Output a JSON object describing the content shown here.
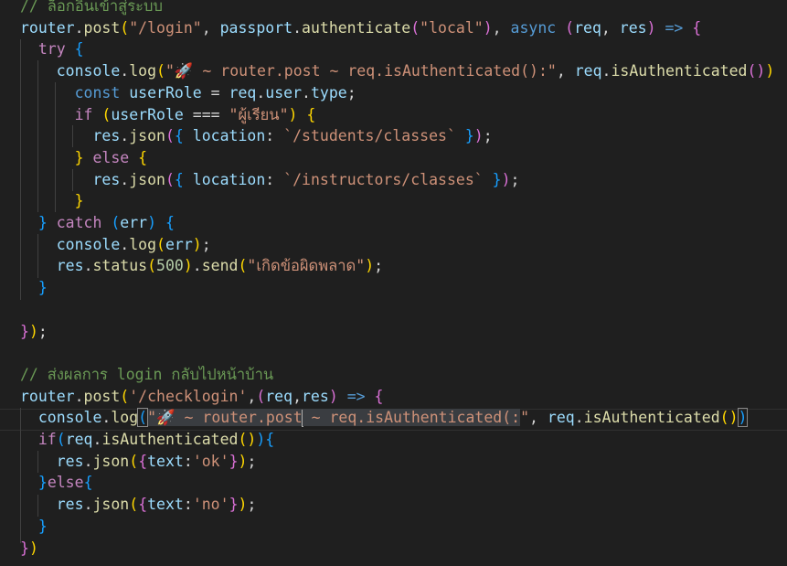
{
  "colors": {
    "background": "#1f1f1f",
    "comment": "#6a9955",
    "variable": "#9cdcfe",
    "function": "#dcdcaa",
    "string": "#ce9178",
    "keyword": "#569cd6",
    "control": "#c586c0",
    "number": "#b5cea8",
    "bracket_1": "#ffd700",
    "bracket_2": "#da70d6",
    "bracket_3": "#179fff"
  },
  "icons": {
    "rocket": "rocket-emoji"
  },
  "code": {
    "lines": [
      [
        [
          "cmt",
          "// ล็อกอินเข้าสู่ระบบ"
        ]
      ],
      [
        [
          "var",
          "router"
        ],
        [
          "txt",
          "."
        ],
        [
          "fn",
          "post"
        ],
        [
          "p1",
          "("
        ],
        [
          "str",
          "\"/login\""
        ],
        [
          "txt",
          ", "
        ],
        [
          "var",
          "passport"
        ],
        [
          "txt",
          "."
        ],
        [
          "fn",
          "authenticate"
        ],
        [
          "p2",
          "("
        ],
        [
          "str",
          "\"local\""
        ],
        [
          "p2",
          ")"
        ],
        [
          "txt",
          ", "
        ],
        [
          "kw",
          "async"
        ],
        [
          "txt",
          " "
        ],
        [
          "p2",
          "("
        ],
        [
          "var",
          "req"
        ],
        [
          "txt",
          ", "
        ],
        [
          "var",
          "res"
        ],
        [
          "p2",
          ")"
        ],
        [
          "txt",
          " "
        ],
        [
          "kw",
          "=>"
        ],
        [
          "txt",
          " "
        ],
        [
          "p2",
          "{"
        ]
      ],
      [
        [
          "txt",
          "  "
        ],
        [
          "ctl",
          "try"
        ],
        [
          "txt",
          " "
        ],
        [
          "p3",
          "{"
        ]
      ],
      [
        [
          "txt",
          "    "
        ],
        [
          "var",
          "console"
        ],
        [
          "txt",
          "."
        ],
        [
          "fn",
          "log"
        ],
        [
          "p1",
          "("
        ],
        [
          "str",
          "\"🚀 ~ router.post ~ req.isAuthenticated():\""
        ],
        [
          "txt",
          ", "
        ],
        [
          "var",
          "req"
        ],
        [
          "txt",
          "."
        ],
        [
          "fn",
          "isAuthenticated"
        ],
        [
          "p2",
          "()"
        ],
        [
          "p1",
          ")"
        ]
      ],
      [
        [
          "txt",
          "      "
        ],
        [
          "kw",
          "const"
        ],
        [
          "txt",
          " "
        ],
        [
          "var",
          "userRole"
        ],
        [
          "txt",
          " = "
        ],
        [
          "var",
          "req"
        ],
        [
          "txt",
          "."
        ],
        [
          "var",
          "user"
        ],
        [
          "txt",
          "."
        ],
        [
          "var",
          "type"
        ],
        [
          "txt",
          ";"
        ]
      ],
      [
        [
          "txt",
          "      "
        ],
        [
          "ctl",
          "if"
        ],
        [
          "txt",
          " "
        ],
        [
          "p1",
          "("
        ],
        [
          "var",
          "userRole"
        ],
        [
          "txt",
          " === "
        ],
        [
          "str",
          "\"ผู้เรียน\""
        ],
        [
          "p1",
          ")"
        ],
        [
          "txt",
          " "
        ],
        [
          "p1",
          "{"
        ]
      ],
      [
        [
          "txt",
          "        "
        ],
        [
          "var",
          "res"
        ],
        [
          "txt",
          "."
        ],
        [
          "fn",
          "json"
        ],
        [
          "p2",
          "("
        ],
        [
          "p3",
          "{"
        ],
        [
          "txt",
          " "
        ],
        [
          "var",
          "location"
        ],
        [
          "txt",
          ": "
        ],
        [
          "str",
          "`/students/classes`"
        ],
        [
          "txt",
          " "
        ],
        [
          "p3",
          "}"
        ],
        [
          "p2",
          ")"
        ],
        [
          "txt",
          ";"
        ]
      ],
      [
        [
          "txt",
          "      "
        ],
        [
          "p1",
          "}"
        ],
        [
          "txt",
          " "
        ],
        [
          "ctl",
          "else"
        ],
        [
          "txt",
          " "
        ],
        [
          "p1",
          "{"
        ]
      ],
      [
        [
          "txt",
          "        "
        ],
        [
          "var",
          "res"
        ],
        [
          "txt",
          "."
        ],
        [
          "fn",
          "json"
        ],
        [
          "p2",
          "("
        ],
        [
          "p3",
          "{"
        ],
        [
          "txt",
          " "
        ],
        [
          "var",
          "location"
        ],
        [
          "txt",
          ": "
        ],
        [
          "str",
          "`/instructors/classes`"
        ],
        [
          "txt",
          " "
        ],
        [
          "p3",
          "}"
        ],
        [
          "p2",
          ")"
        ],
        [
          "txt",
          ";"
        ]
      ],
      [
        [
          "txt",
          "      "
        ],
        [
          "p1",
          "}"
        ]
      ],
      [
        [
          "txt",
          "  "
        ],
        [
          "p3",
          "}"
        ],
        [
          "txt",
          " "
        ],
        [
          "ctl",
          "catch"
        ],
        [
          "txt",
          " "
        ],
        [
          "p3",
          "("
        ],
        [
          "var",
          "err"
        ],
        [
          "p3",
          ")"
        ],
        [
          "txt",
          " "
        ],
        [
          "p3",
          "{"
        ]
      ],
      [
        [
          "txt",
          "    "
        ],
        [
          "var",
          "console"
        ],
        [
          "txt",
          "."
        ],
        [
          "fn",
          "log"
        ],
        [
          "p1",
          "("
        ],
        [
          "var",
          "err"
        ],
        [
          "p1",
          ")"
        ],
        [
          "txt",
          ";"
        ]
      ],
      [
        [
          "txt",
          "    "
        ],
        [
          "var",
          "res"
        ],
        [
          "txt",
          "."
        ],
        [
          "fn",
          "status"
        ],
        [
          "p1",
          "("
        ],
        [
          "num",
          "500"
        ],
        [
          "p1",
          ")"
        ],
        [
          "txt",
          "."
        ],
        [
          "fn",
          "send"
        ],
        [
          "p1",
          "("
        ],
        [
          "str",
          "\"เกิดข้อผิดพลาด\""
        ],
        [
          "p1",
          ")"
        ],
        [
          "txt",
          ";"
        ]
      ],
      [
        [
          "txt",
          "  "
        ],
        [
          "p3",
          "}"
        ]
      ],
      [],
      [
        [
          "p2",
          "}"
        ],
        [
          "p1",
          ")"
        ],
        [
          "txt",
          ";"
        ]
      ],
      [],
      [
        [
          "cmt",
          "// ส่งผลการ login กลับไปหน้าบ้าน"
        ]
      ],
      [
        [
          "var",
          "router"
        ],
        [
          "txt",
          "."
        ],
        [
          "fn",
          "post"
        ],
        [
          "p1",
          "("
        ],
        [
          "str",
          "'/checklogin'"
        ],
        [
          "txt",
          ","
        ],
        [
          "p2",
          "("
        ],
        [
          "var",
          "req"
        ],
        [
          "txt",
          ","
        ],
        [
          "var",
          "res"
        ],
        [
          "p2",
          ")"
        ],
        [
          "txt",
          " "
        ],
        [
          "kw",
          "=>"
        ],
        [
          "txt",
          " "
        ],
        [
          "p2",
          "{"
        ]
      ],
      [
        [
          "txt",
          "  "
        ],
        [
          "var",
          "console"
        ],
        [
          "txt",
          "."
        ],
        [
          "fn",
          "log"
        ],
        [
          "p3bm",
          "("
        ],
        [
          "strsel",
          "\"🚀 ~ router.post"
        ],
        [
          "cursor",
          ""
        ],
        [
          "strsel",
          " ~ req.isAuthenticated(:"
        ],
        [
          "str",
          "\""
        ],
        [
          "txt",
          ", "
        ],
        [
          "var",
          "req"
        ],
        [
          "txt",
          "."
        ],
        [
          "fn",
          "isAuthenticated"
        ],
        [
          "p1",
          "()"
        ],
        [
          "p3bm",
          ")"
        ]
      ],
      [
        [
          "txt",
          "  "
        ],
        [
          "ctl",
          "if"
        ],
        [
          "p3",
          "("
        ],
        [
          "var",
          "req"
        ],
        [
          "txt",
          "."
        ],
        [
          "fn",
          "isAuthenticated"
        ],
        [
          "p1",
          "()"
        ],
        [
          "p3",
          ")"
        ],
        [
          "p3",
          "{"
        ]
      ],
      [
        [
          "txt",
          "    "
        ],
        [
          "var",
          "res"
        ],
        [
          "txt",
          "."
        ],
        [
          "fn",
          "json"
        ],
        [
          "p1",
          "("
        ],
        [
          "p2",
          "{"
        ],
        [
          "var",
          "text"
        ],
        [
          "txt",
          ":"
        ],
        [
          "str",
          "'ok'"
        ],
        [
          "p2",
          "}"
        ],
        [
          "p1",
          ")"
        ],
        [
          "txt",
          ";"
        ]
      ],
      [
        [
          "txt",
          "  "
        ],
        [
          "p3",
          "}"
        ],
        [
          "ctl",
          "else"
        ],
        [
          "p3",
          "{"
        ]
      ],
      [
        [
          "txt",
          "    "
        ],
        [
          "var",
          "res"
        ],
        [
          "txt",
          "."
        ],
        [
          "fn",
          "json"
        ],
        [
          "p1",
          "("
        ],
        [
          "p2",
          "{"
        ],
        [
          "var",
          "text"
        ],
        [
          "txt",
          ":"
        ],
        [
          "str",
          "'no'"
        ],
        [
          "p2",
          "}"
        ],
        [
          "p1",
          ")"
        ],
        [
          "txt",
          ";"
        ]
      ],
      [
        [
          "txt",
          "  "
        ],
        [
          "p3",
          "}"
        ]
      ],
      [
        [
          "p2",
          "}"
        ],
        [
          "p1",
          ")"
        ]
      ]
    ]
  }
}
